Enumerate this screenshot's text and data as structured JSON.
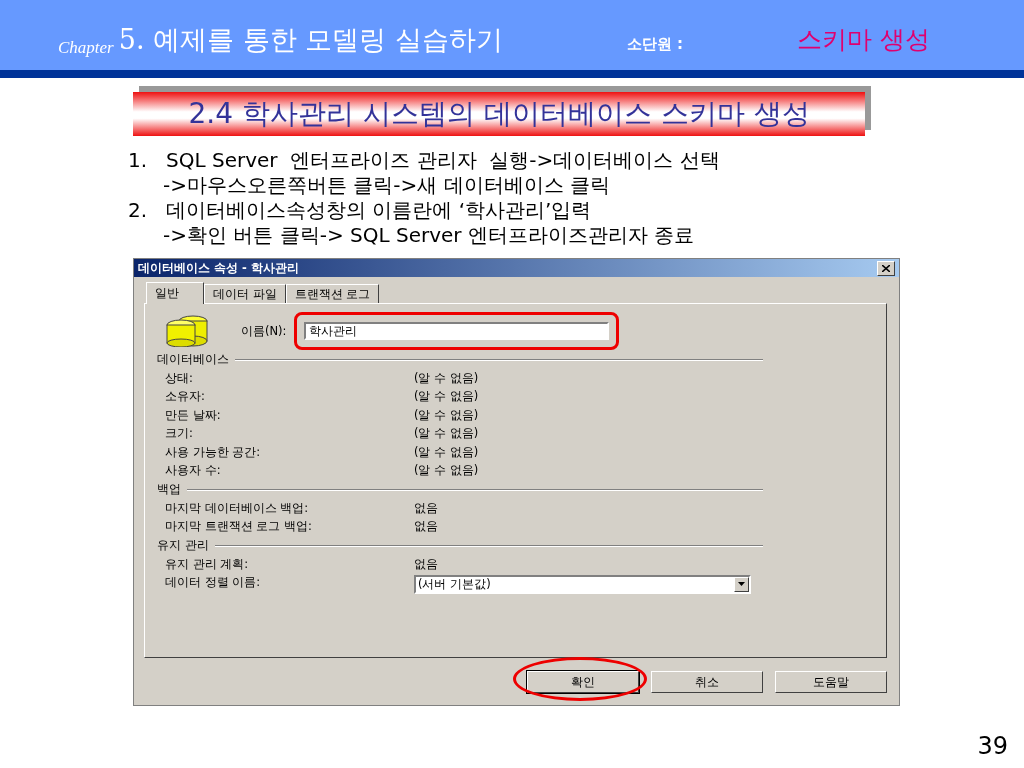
{
  "header": {
    "chapter_label": "Chapter",
    "chapter_title": "5. 예제를 통한 모델링 실습하기",
    "subunit_label": "소단원 :",
    "subunit_title": "스키마 생성"
  },
  "title": "2.4 학사관리 시스템의 데이터베이스 스키마 생성",
  "steps": [
    {
      "number": "1.",
      "lines": [
        "SQL Server  엔터프라이즈 관리자  실행->데이터베이스 선택",
        "->마우스오른쪽버튼 클릭->새 데이터베이스 클릭"
      ]
    },
    {
      "number": "2.",
      "lines": [
        "데이터베이스속성창의 이름란에 ‘학사관리’입력",
        "->확인 버튼 클릭-> SQL Server 엔터프라이즈관리자 종료"
      ]
    }
  ],
  "dialog": {
    "title": "데이터베이스 속성 - 학사관리",
    "tabs": [
      {
        "label": "일반",
        "selected": true
      },
      {
        "label": "데이터 파일",
        "selected": false
      },
      {
        "label": "트랜잭션 로그",
        "selected": false
      }
    ],
    "name_label": "이름(N):",
    "name_value": "학사관리",
    "name_highlighted": true,
    "sections": [
      {
        "title": "데이터베이스",
        "rows": [
          {
            "kind": "text",
            "label": "상태:",
            "value": "(알 수 없음)"
          },
          {
            "kind": "text",
            "label": "소유자:",
            "value": "(알 수 없음)"
          },
          {
            "kind": "text",
            "label": "만든 날짜:",
            "value": "(알 수 없음)"
          },
          {
            "kind": "text",
            "label": "크기:",
            "value": "(알 수 없음)"
          },
          {
            "kind": "text",
            "label": "사용 가능한 공간:",
            "value": "(알 수 없음)"
          },
          {
            "kind": "text",
            "label": "사용자 수:",
            "value": "(알 수 없음)"
          }
        ]
      },
      {
        "title": "백업",
        "rows": [
          {
            "kind": "text",
            "label": "마지막 데이터베이스 백업:",
            "value": "없음"
          },
          {
            "kind": "text",
            "label": "마지막 트랜잭션 로그 백업:",
            "value": "없음"
          }
        ]
      },
      {
        "title": "유지 관리",
        "rows": [
          {
            "kind": "text",
            "label": "유지 관리 계획:",
            "value": "없음"
          },
          {
            "kind": "dropdown",
            "label": "데이터 정렬 이름:",
            "value": "(서버 기본값)"
          }
        ]
      }
    ],
    "buttons": [
      {
        "label": "확인",
        "highlighted": true
      },
      {
        "label": "취소",
        "highlighted": false
      },
      {
        "label": "도움말",
        "highlighted": false
      }
    ]
  },
  "page_number": "39"
}
